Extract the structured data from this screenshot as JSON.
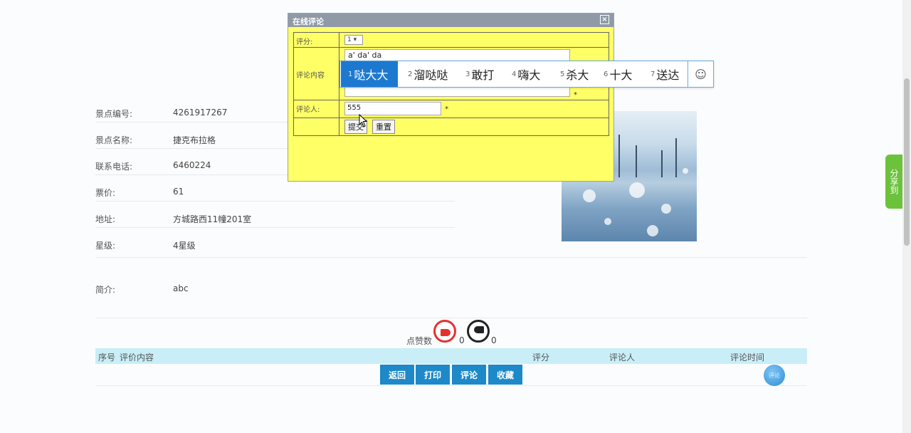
{
  "details": [
    {
      "label": "景点编号:",
      "value": "4261917267"
    },
    {
      "label": "景点名称:",
      "value": "捷克布拉格"
    },
    {
      "label": "联系电话:",
      "value": "6460224"
    },
    {
      "label": "票价:",
      "value": "61"
    },
    {
      "label": "地址:",
      "value": "方城路西11幢201室"
    },
    {
      "label": "星级:",
      "value": "4星级"
    }
  ],
  "intro": {
    "label": "简介:",
    "value": "abc"
  },
  "likes": {
    "label": "点赞数",
    "up_count": "0",
    "down_count": "0"
  },
  "table": {
    "col_index": "序号",
    "col_content": "评价内容",
    "col_score": "评分",
    "col_user": "评论人",
    "col_time": "评论时间"
  },
  "buttons": {
    "back": "返回",
    "print": "打印",
    "comment": "评论",
    "favorite": "收藏",
    "round": "评论"
  },
  "share_tab": "分享到",
  "dialog": {
    "title": "在线评论",
    "close": "×",
    "rating_label": "评分:",
    "rating_value": "1 ▾",
    "content_label": "评论内容",
    "content_value": "a' da' da",
    "user_label": "评论人:",
    "user_value": "555",
    "required_mark": "*",
    "submit": "提交",
    "reset": "重置"
  },
  "ime": {
    "candidates": [
      {
        "num": "1",
        "text": "哒大大"
      },
      {
        "num": "2",
        "text": "溜哒哒"
      },
      {
        "num": "3",
        "text": "敢打"
      },
      {
        "num": "4",
        "text": "嗨大"
      },
      {
        "num": "5",
        "text": "杀大"
      },
      {
        "num": "6",
        "text": "十大"
      },
      {
        "num": "7",
        "text": "送达"
      }
    ],
    "emoji": "☺"
  }
}
